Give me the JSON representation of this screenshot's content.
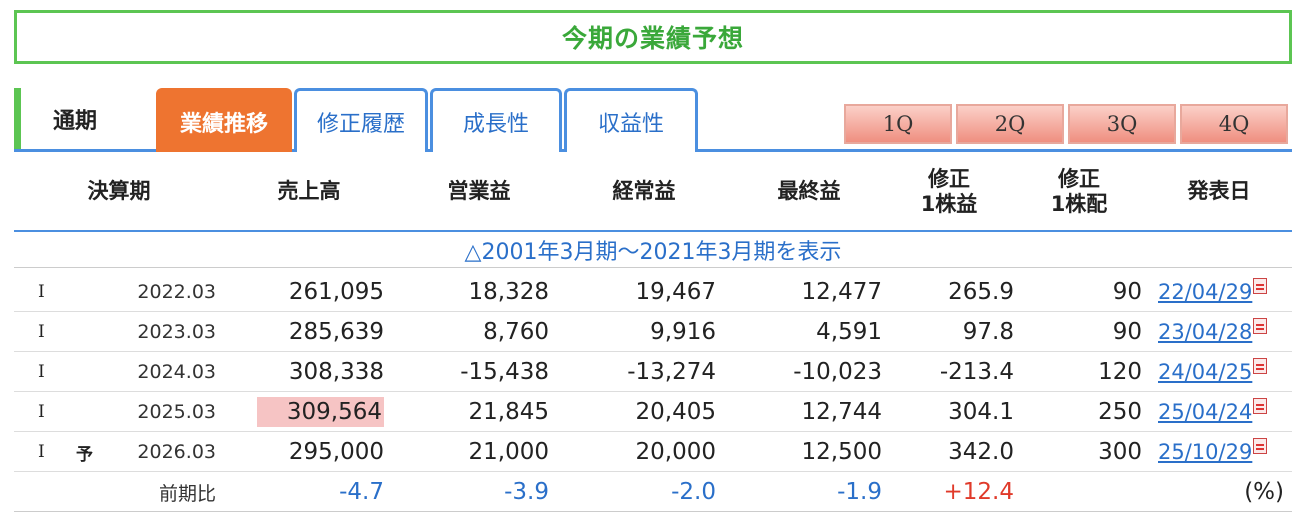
{
  "title": "今期の業績予想",
  "tabs": {
    "static_label": "通期",
    "items": [
      "業績推移",
      "修正履歴",
      "成長性",
      "収益性"
    ],
    "quarters": [
      "1Q",
      "2Q",
      "3Q",
      "4Q"
    ]
  },
  "table": {
    "headers": {
      "period": "決算期",
      "sales": "売上高",
      "operating": "営業益",
      "ordinary": "経常益",
      "net": "最終益",
      "eps_line1": "修正",
      "eps_line2": "1株益",
      "div_line1": "修正",
      "div_line2": "1株配",
      "date": "発表日"
    },
    "range_link": "△2001年3月期～2021年3月期を表示",
    "rows": [
      {
        "mark": "I",
        "forecast": "",
        "period": "2022.03",
        "sales": "261,095",
        "operating": "18,328",
        "ordinary": "19,467",
        "net": "12,477",
        "eps": "265.9",
        "div": "90",
        "date": "22/04/29"
      },
      {
        "mark": "I",
        "forecast": "",
        "period": "2023.03",
        "sales": "285,639",
        "operating": "8,760",
        "ordinary": "9,916",
        "net": "4,591",
        "eps": "97.8",
        "div": "90",
        "date": "23/04/28"
      },
      {
        "mark": "I",
        "forecast": "",
        "period": "2024.03",
        "sales": "308,338",
        "operating": "-15,438",
        "ordinary": "-13,274",
        "net": "-10,023",
        "eps": "-213.4",
        "div": "120",
        "date": "24/04/25"
      },
      {
        "mark": "I",
        "forecast": "",
        "period": "2025.03",
        "sales": "309,564",
        "operating": "21,845",
        "ordinary": "20,405",
        "net": "12,744",
        "eps": "304.1",
        "div": "250",
        "date": "25/04/24"
      },
      {
        "mark": "I",
        "forecast": "予",
        "period": "2026.03",
        "sales": "295,000",
        "operating": "21,000",
        "ordinary": "20,000",
        "net": "12,500",
        "eps": "342.0",
        "div": "300",
        "date": "25/10/29"
      }
    ],
    "comparison": {
      "label": "前期比",
      "sales": "-4.7",
      "operating": "-3.9",
      "ordinary": "-2.0",
      "net": "-1.9",
      "eps": "+12.4",
      "unit": "(%)"
    }
  },
  "colors": {
    "accent_green": "#5cc552",
    "tab_blue": "#4b8fe0",
    "active_orange": "#ee7430",
    "highlight_pink": "#f6c4c4",
    "negative_blue": "#2a6fc9",
    "positive_red": "#e03a2a"
  },
  "icons": {
    "pdf": "pdf-icon"
  }
}
